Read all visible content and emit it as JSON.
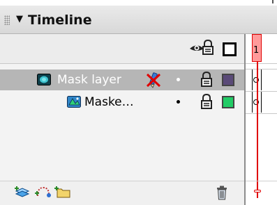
{
  "panel": {
    "title": "Timeline",
    "collapse_arrow": "▼"
  },
  "header_icons": {
    "show_hide": "eye-icon",
    "lock": "padlock-icon",
    "outline": "outline-square-icon"
  },
  "layers": [
    {
      "name": "Mask layer",
      "type_icon": "mask-layer-icon",
      "edit_icon": "pencil-crossed-icon",
      "selected": true,
      "outline_color": "#5a4a78"
    },
    {
      "name": "Maske…",
      "type_icon": "masked-layer-icon",
      "selected": false,
      "outline_color": "#22cc66"
    }
  ],
  "timeline": {
    "frame_number": "1",
    "playhead_color": "#e00000"
  },
  "toolbar": {
    "insert_layer": "insert-layer-icon",
    "add_motion_guide": "add-motion-guide-icon",
    "insert_folder": "insert-folder-icon",
    "delete_layer": "trash-icon"
  }
}
